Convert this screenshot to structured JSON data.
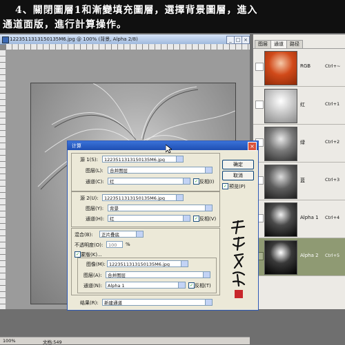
{
  "caption": {
    "line1": "4、關閉圖層1和漸變填充圖層，選擇背景圖層，進入",
    "line2": "通道面版，進行計算操作。"
  },
  "document": {
    "title": "1223511313150135M6.jpg @ 100% (背景, Alpha 2/8)",
    "status_label": "文档:549"
  },
  "panel": {
    "tabs": [
      "图层",
      "通道",
      "路径"
    ],
    "active_tab": 1,
    "channels": [
      {
        "name": "RGB",
        "key": "Ctrl+~"
      },
      {
        "name": "红",
        "key": "Ctrl+1"
      },
      {
        "name": "绿",
        "key": "Ctrl+2"
      },
      {
        "name": "蓝",
        "key": "Ctrl+3"
      },
      {
        "name": "Alpha 1",
        "key": "Ctrl+4"
      },
      {
        "name": "Alpha 2",
        "key": "Ctrl+5"
      }
    ],
    "selected_channel": 5
  },
  "dialog": {
    "title": "计算",
    "source1": {
      "label": "源 1(S):",
      "file": "1223511313150135M6.jpg",
      "layer_label": "图层(L):",
      "layer": "合并图层",
      "channel_label": "通道(C):",
      "channel": "红",
      "invert_label": "反相(I)",
      "invert": true
    },
    "source2": {
      "label": "源 2(U):",
      "file": "1223511313150135M6.jpg",
      "layer_label": "图层(Y):",
      "layer": "背景",
      "channel_label": "通道(H):",
      "channel": "红",
      "invert_label": "反相(V)",
      "invert": true
    },
    "blend_label": "混合(B):",
    "blend": "正片叠底",
    "opacity_label": "不透明度(O):",
    "opacity": "100",
    "opacity_unit": "%",
    "mask_label": "蒙版(K)...",
    "mask_checked": true,
    "mask": {
      "image_label": "图像(M):",
      "image": "1223511313150135M6.jpg",
      "layer_label": "图层(A):",
      "layer": "合并图层",
      "channel_label": "通道(N):",
      "channel": "Alpha 1",
      "invert_label": "反相(T)",
      "invert": true
    },
    "result_label": "结果(R):",
    "result": "新建通道",
    "ok": "确定",
    "cancel": "取消",
    "preview_label": "预览(P)",
    "preview": true
  }
}
